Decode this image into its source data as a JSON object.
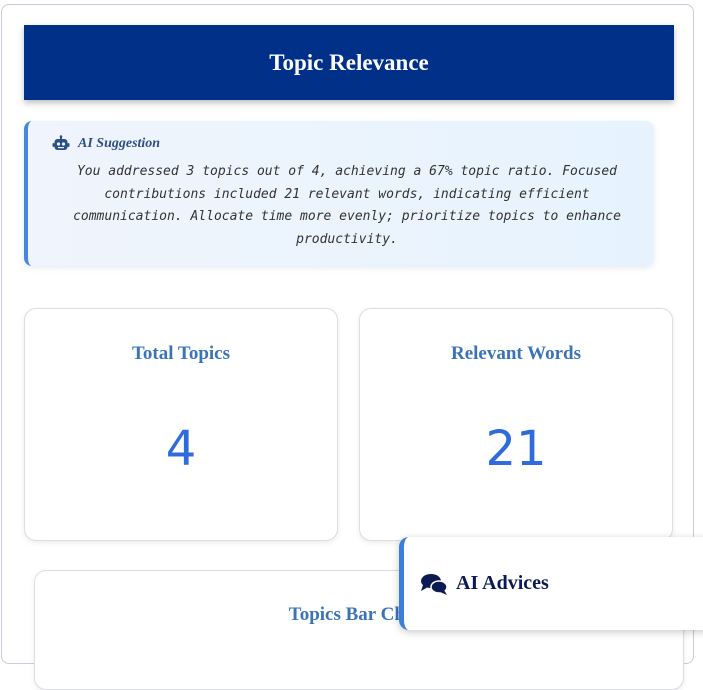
{
  "header": {
    "title": "Topic Relevance"
  },
  "suggestion": {
    "title": "AI Suggestion",
    "icon": "robot-icon",
    "text": "You addressed 3 topics out of 4, achieving a 67% topic ratio. Focused contributions included 21 relevant words, indicating efficient communication. Allocate time more evenly; prioritize topics to enhance productivity."
  },
  "stats": [
    {
      "label": "Total Topics",
      "value": "4"
    },
    {
      "label": "Relevant Words",
      "value": "21"
    }
  ],
  "chart": {
    "title": "Topics Bar Chart"
  },
  "advices_panel": {
    "label": "AI Advices",
    "icon": "chat-bubbles-icon"
  },
  "colors": {
    "header_bg": "#003087",
    "accent": "#4a86d9",
    "stat_value": "#2f6bdc",
    "card_title": "#3b73b9"
  }
}
